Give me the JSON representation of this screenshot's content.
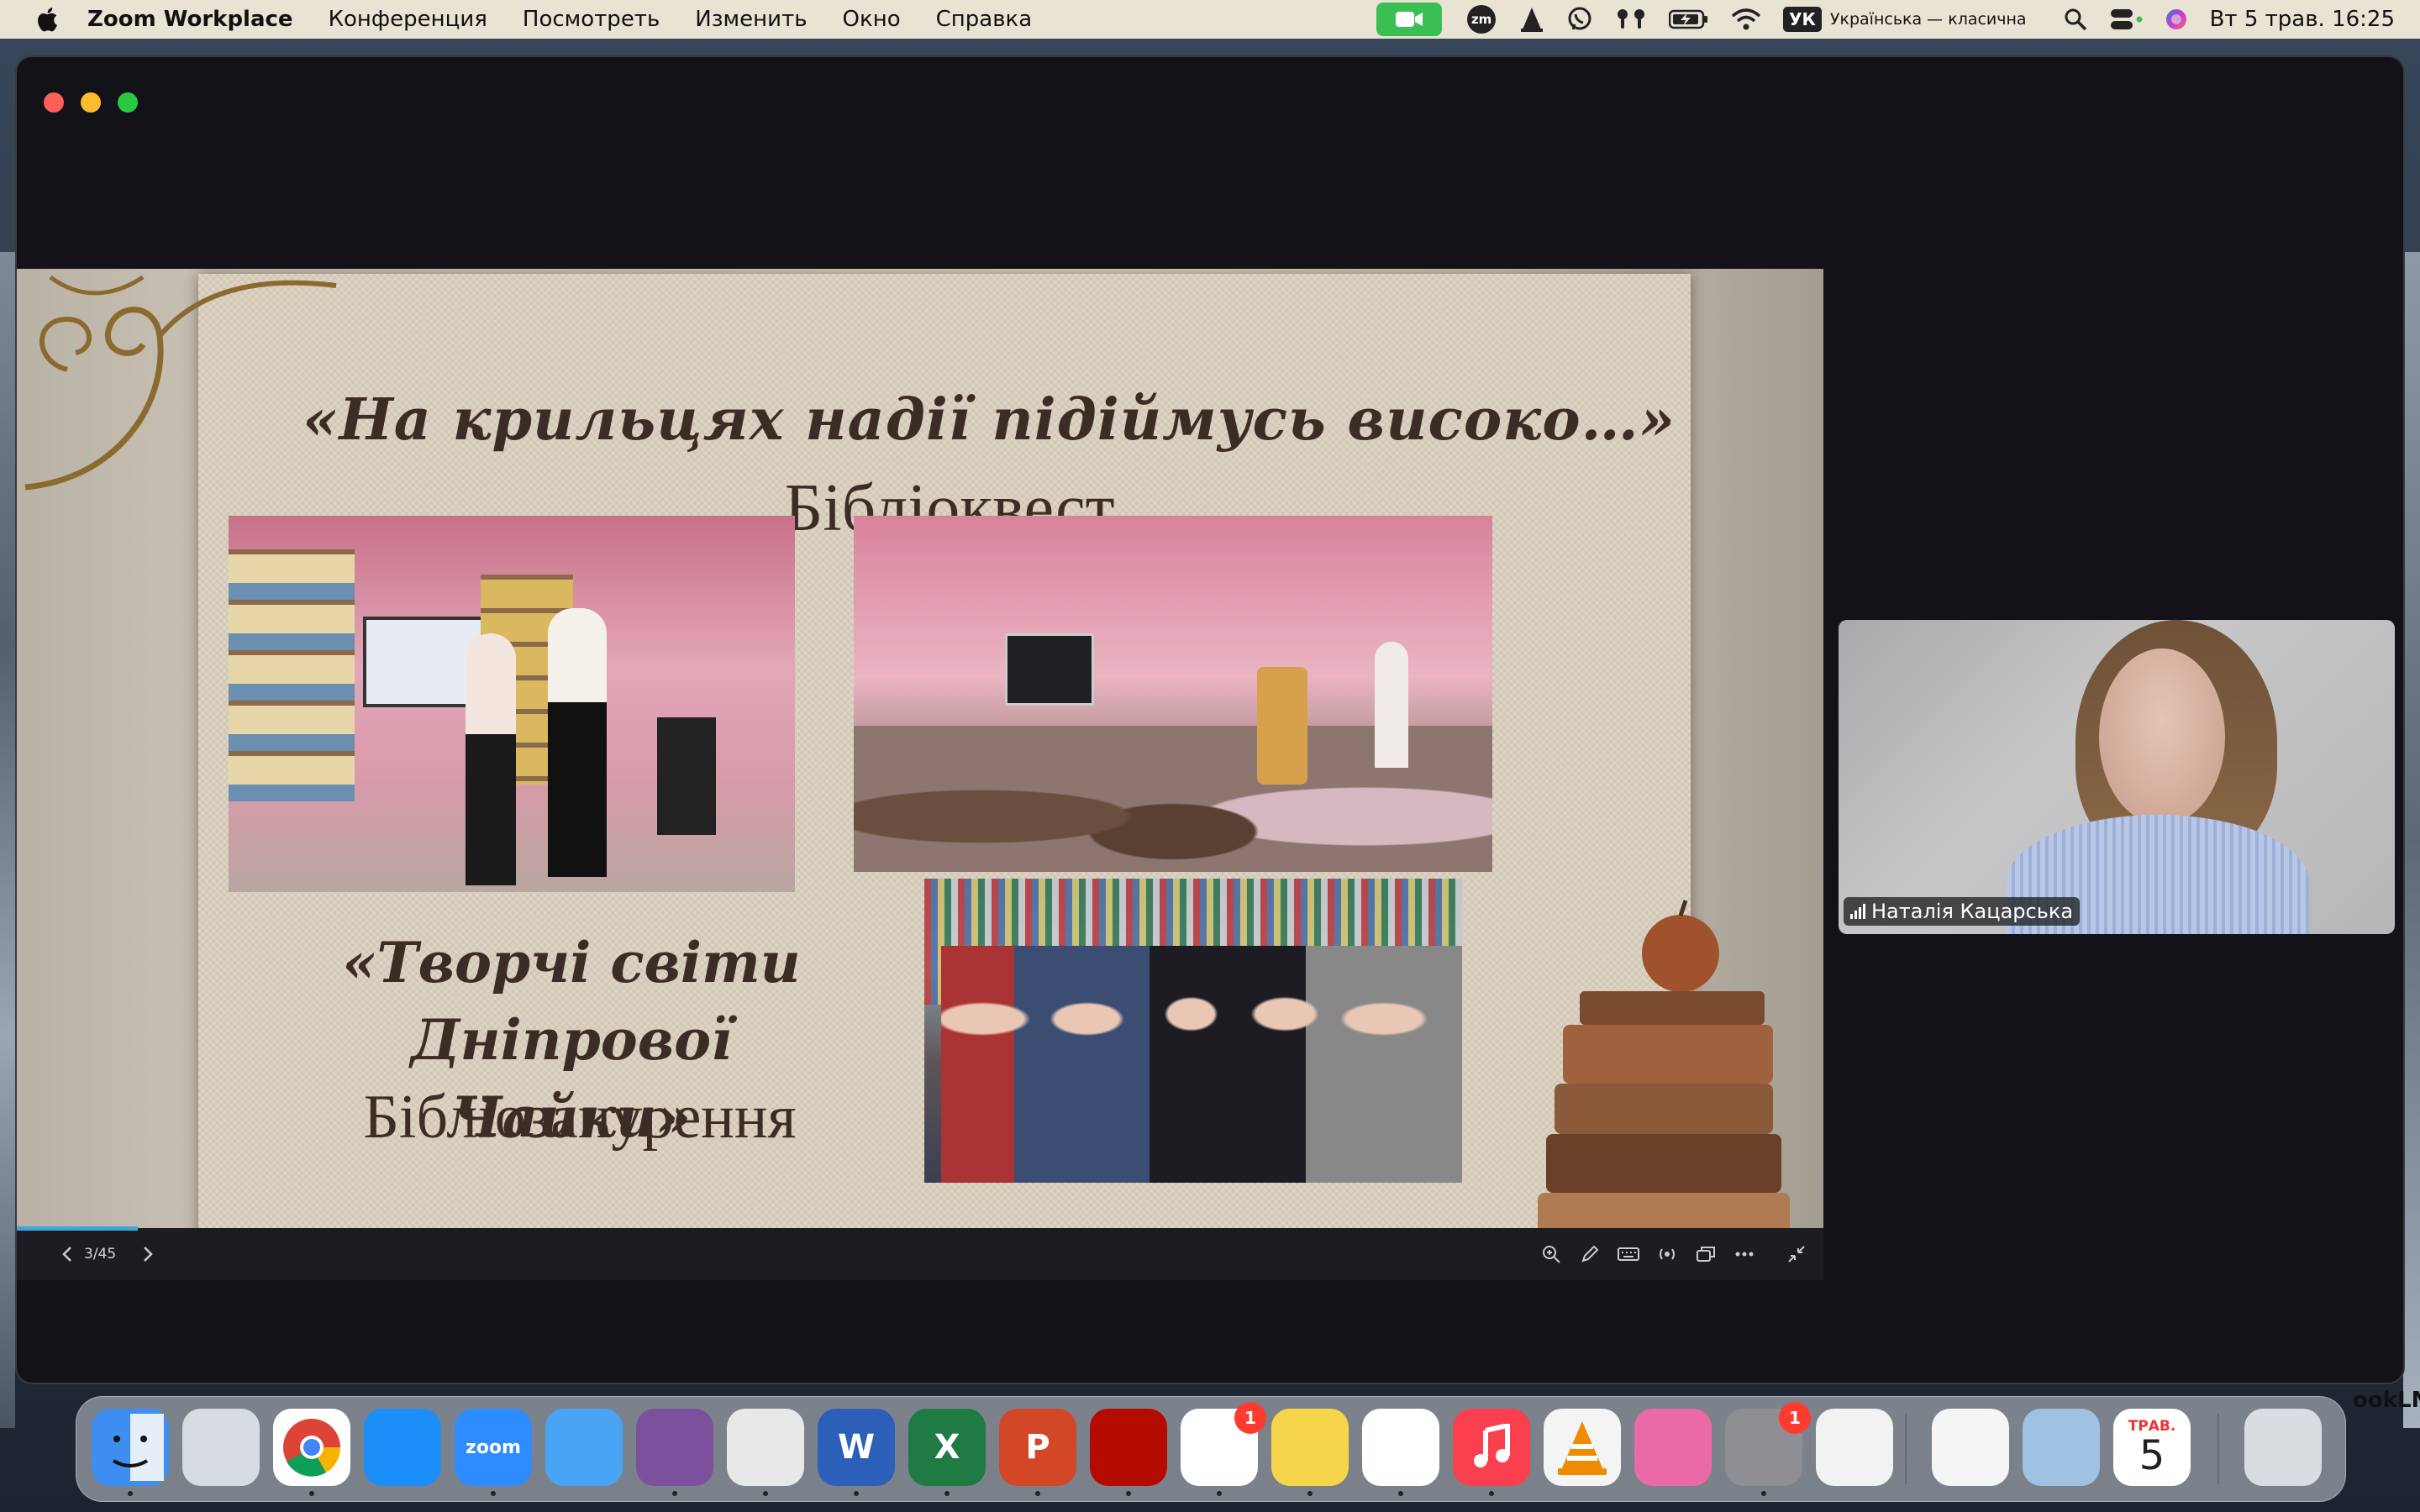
{
  "menubar": {
    "app_name": "Zoom Workplace",
    "menus": [
      "Конференция",
      "Посмотреть",
      "Изменить",
      "Окно",
      "Справка"
    ],
    "status_icons": [
      "zoom-video-icon",
      "zm-icon",
      "cone-icon",
      "viber-icon",
      "airpods-icon",
      "battery-icon",
      "wifi-icon"
    ],
    "input_source_badge": "УК",
    "input_source_name": "Українська — класична",
    "datetime": "Вт 5 трав.  16:25"
  },
  "slide": {
    "title": "«На крильцях надії підіймусь високо…»",
    "subtitle": "Бібліоквест",
    "title2_line1": "«Творчі світи",
    "title2_line2": "Дніпрової Чайки»",
    "subtitle2": "Бібліозанурення",
    "page_counter": "3/45",
    "progress_fraction": 0.067
  },
  "video": {
    "participant_name": "Наталія Кацарська"
  },
  "dock": {
    "apps": [
      {
        "name": "finder",
        "label": "",
        "color": "#3d8ef0"
      },
      {
        "name": "launchpad",
        "label": "",
        "color": "#d7dbe2"
      },
      {
        "name": "chrome",
        "label": "",
        "color": "#ffffff"
      },
      {
        "name": "app-store",
        "label": "",
        "color": "#1c8ef9"
      },
      {
        "name": "zoom",
        "label": "zoom",
        "color": "#2d8cff"
      },
      {
        "name": "mail",
        "label": "",
        "color": "#4aa3f5"
      },
      {
        "name": "viber",
        "label": "",
        "color": "#7b519d"
      },
      {
        "name": "doctor",
        "label": "",
        "color": "#e8e8e8"
      },
      {
        "name": "word",
        "label": "W",
        "color": "#2b5fb8"
      },
      {
        "name": "excel",
        "label": "X",
        "color": "#1f7a44"
      },
      {
        "name": "powerpoint",
        "label": "P",
        "color": "#d24726"
      },
      {
        "name": "acrobat",
        "label": "",
        "color": "#b30b00"
      },
      {
        "name": "reminders",
        "label": "",
        "color": "#ffffff",
        "badge": "1"
      },
      {
        "name": "notes",
        "label": "",
        "color": "#f7d54a"
      },
      {
        "name": "freeform",
        "label": "",
        "color": "#ffffff"
      },
      {
        "name": "music",
        "label": "",
        "color": "#fa3f4f"
      },
      {
        "name": "vlc",
        "label": "",
        "color": "#f4f4f4"
      },
      {
        "name": "cleanmymac",
        "label": "",
        "color": "#e96aa7"
      },
      {
        "name": "system-settings",
        "label": "",
        "color": "#8e8e93",
        "badge": "1"
      },
      {
        "name": "iphone-mirroring",
        "label": "",
        "color": "#f2f2f2"
      },
      {
        "name": "textedit",
        "label": "",
        "color": "#f5f5f5"
      },
      {
        "name": "preview",
        "label": "",
        "color": "#9fc1e2"
      },
      {
        "name": "calendar",
        "label": "",
        "color": "#ffffff",
        "month": "ТРАВ.",
        "day": "5"
      },
      {
        "name": "trash",
        "label": "",
        "color": "#d9dde2"
      }
    ]
  },
  "desktop": {
    "partial_label": "ookLM"
  }
}
